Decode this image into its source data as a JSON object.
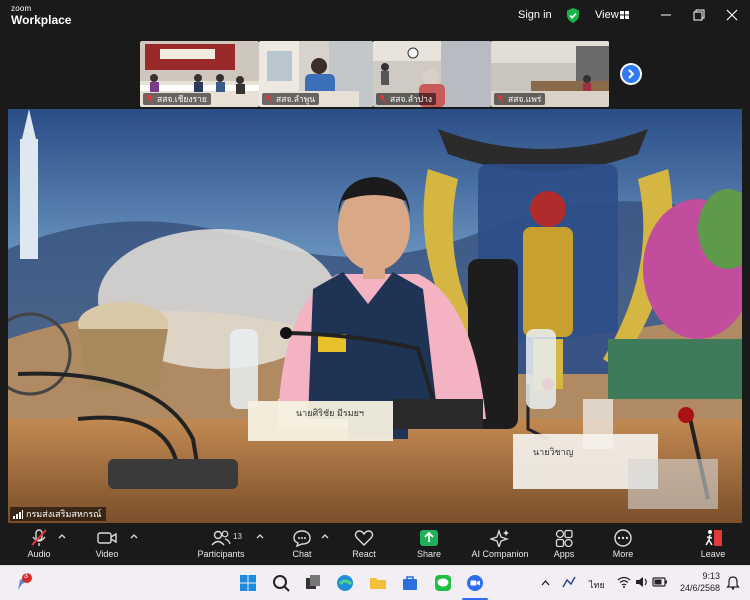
{
  "app": {
    "brand_small": "zoom",
    "brand_large": "Workplace"
  },
  "titlebar": {
    "signin_label": "Sign in",
    "view_label": "View",
    "shield_icon": "shield-check-icon",
    "accent_green": "#19b34a"
  },
  "thumbnails": [
    {
      "label": "สสจ.เชียงราย"
    },
    {
      "label": "สสจ.ลำพูน"
    },
    {
      "label": "สสจ.ลำปาง"
    },
    {
      "label": "สสจ.แพร่"
    }
  ],
  "main_video": {
    "speaker_label": "กรมส่งเสริมสหกรณ์",
    "nameplate": "นายศิริชัย มีรมยฯ",
    "nameplate_right": "นายวิชาญ"
  },
  "toolbar": {
    "audio": "Audio",
    "video": "Video",
    "participants": "Participants",
    "participants_count": "13",
    "chat": "Chat",
    "react": "React",
    "share": "Share",
    "ai_companion": "AI Companion",
    "apps": "Apps",
    "more": "More",
    "leave": "Leave",
    "share_color": "#1fb25a",
    "leave_color": "#e23a3a"
  },
  "taskbar": {
    "notification_count": "3",
    "language": "ไทย",
    "time": "9:13",
    "date": "24/6/2568"
  }
}
